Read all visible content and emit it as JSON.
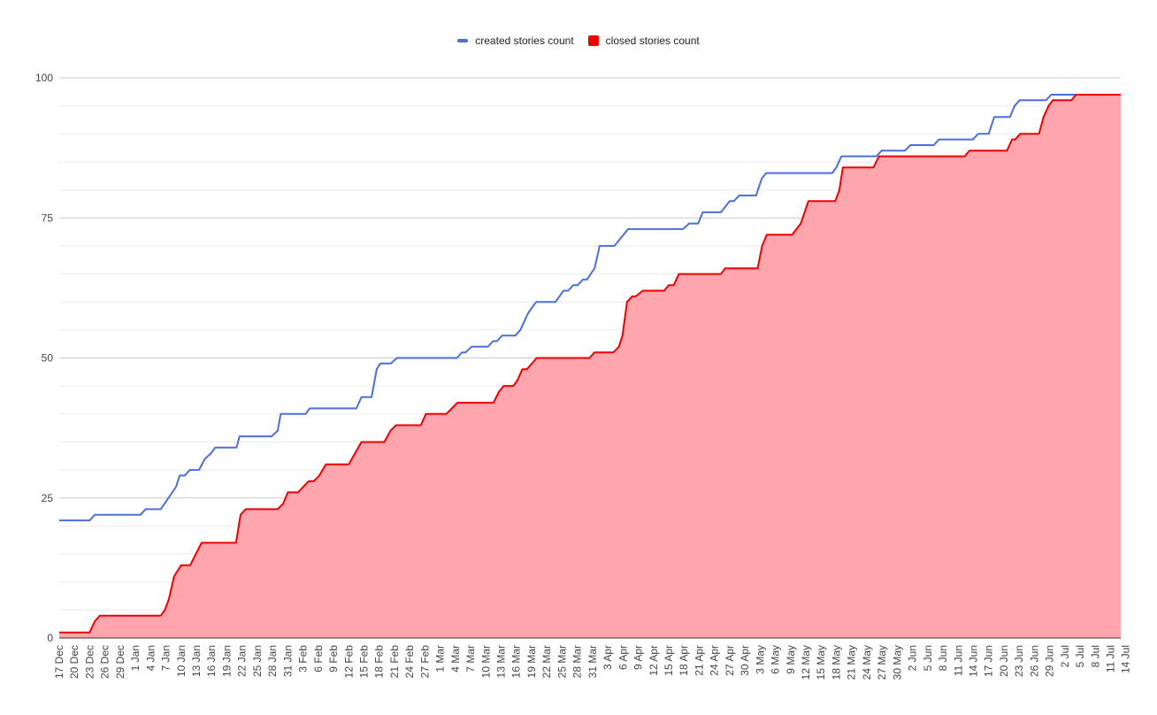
{
  "chart_data": {
    "type": "area",
    "title": "",
    "xlabel": "",
    "ylabel": "",
    "ylim": [
      0,
      100
    ],
    "y_ticks": [
      "0",
      "25",
      "50",
      "75",
      "100"
    ],
    "y_minor_step": 5,
    "grid": true,
    "legend_position": "top-center",
    "x_start": "17 Dec",
    "x_end": "14 Jul",
    "x_total_days": 209,
    "x_tick_labels": [
      "17 Dec",
      "20 Dec",
      "23 Dec",
      "26 Dec",
      "29 Dec",
      "1 Jan",
      "4 Jan",
      "7 Jan",
      "10 Jan",
      "13 Jan",
      "16 Jan",
      "19 Jan",
      "22 Jan",
      "25 Jan",
      "28 Jan",
      "31 Jan",
      "3 Feb",
      "6 Feb",
      "9 Feb",
      "12 Feb",
      "15 Feb",
      "18 Feb",
      "21 Feb",
      "24 Feb",
      "27 Feb",
      "1 Mar",
      "4 Mar",
      "7 Mar",
      "10 Mar",
      "13 Mar",
      "16 Mar",
      "19 Mar",
      "22 Mar",
      "25 Mar",
      "28 Mar",
      "31 Mar",
      "3 Apr",
      "6 Apr",
      "9 Apr",
      "12 Apr",
      "15 Apr",
      "18 Apr",
      "21 Apr",
      "24 Apr",
      "27 Apr",
      "30 Apr",
      "3 May",
      "6 May",
      "9 May",
      "12 May",
      "15 May",
      "18 May",
      "21 May",
      "24 May",
      "27 May",
      "30 May",
      "2 Jun",
      "5 Jun",
      "8 Jun",
      "11 Jun",
      "14 Jun",
      "17 Jun",
      "20 Jun",
      "23 Jun",
      "26 Jun",
      "29 Jun",
      "2 Jul",
      "5 Jul",
      "8 Jul",
      "11 Jul",
      "14 Jul"
    ],
    "series": [
      {
        "name": "created stories count",
        "style": "line",
        "color": "#4a6ee0",
        "points_day_value": [
          [
            0,
            21
          ],
          [
            6,
            21
          ],
          [
            7,
            22
          ],
          [
            16,
            22
          ],
          [
            17,
            23
          ],
          [
            20,
            23
          ],
          [
            23,
            27
          ],
          [
            23.7,
            29
          ],
          [
            24.7,
            29
          ],
          [
            25.7,
            30
          ],
          [
            27.5,
            30
          ],
          [
            28.7,
            32
          ],
          [
            29.9,
            33
          ],
          [
            30.7,
            34
          ],
          [
            34.9,
            34
          ],
          [
            35.5,
            36
          ],
          [
            41.8,
            36
          ],
          [
            43,
            37
          ],
          [
            43.6,
            40
          ],
          [
            48.5,
            40
          ],
          [
            49.3,
            41
          ],
          [
            58.5,
            41
          ],
          [
            59.5,
            43
          ],
          [
            61.5,
            43
          ],
          [
            62.5,
            48
          ],
          [
            63.2,
            49
          ],
          [
            65.3,
            49
          ],
          [
            66.5,
            50
          ],
          [
            78.3,
            50
          ],
          [
            79.3,
            51
          ],
          [
            80,
            51
          ],
          [
            81.2,
            52
          ],
          [
            84.4,
            52
          ],
          [
            85.4,
            53
          ],
          [
            86.2,
            53
          ],
          [
            87.2,
            54
          ],
          [
            89.8,
            54
          ],
          [
            90.8,
            55
          ],
          [
            92.3,
            58
          ],
          [
            93.1,
            59
          ],
          [
            93.9,
            60
          ],
          [
            97.7,
            60
          ],
          [
            99.3,
            62
          ],
          [
            100.2,
            62
          ],
          [
            101.2,
            63
          ],
          [
            102.1,
            63
          ],
          [
            103.1,
            64
          ],
          [
            103.9,
            64
          ],
          [
            105.4,
            66
          ],
          [
            106.4,
            70
          ],
          [
            109.3,
            70
          ],
          [
            112,
            73
          ],
          [
            122.8,
            73
          ],
          [
            124,
            74
          ],
          [
            125.8,
            74
          ],
          [
            126.7,
            76
          ],
          [
            130.3,
            76
          ],
          [
            132,
            78
          ],
          [
            132.8,
            78
          ],
          [
            133.9,
            79
          ],
          [
            137.2,
            79
          ],
          [
            138.3,
            82
          ],
          [
            139.2,
            83
          ],
          [
            152.2,
            83
          ],
          [
            153,
            84
          ],
          [
            154,
            86
          ],
          [
            160.9,
            86
          ],
          [
            161.9,
            87
          ],
          [
            166.5,
            87
          ],
          [
            167.6,
            88
          ],
          [
            172.2,
            88
          ],
          [
            173.2,
            89
          ],
          [
            179.9,
            89
          ],
          [
            180.9,
            90
          ],
          [
            183,
            90
          ],
          [
            184.1,
            93
          ],
          [
            187.2,
            93
          ],
          [
            188.1,
            95
          ],
          [
            189.1,
            96
          ],
          [
            194.3,
            96
          ],
          [
            195.3,
            97
          ],
          [
            209,
            97
          ]
        ]
      },
      {
        "name": "closed stories count",
        "style": "area",
        "color": "#ee0000",
        "fill": "#ffa5ad",
        "points_day_value": [
          [
            0,
            1
          ],
          [
            6,
            1
          ],
          [
            7,
            3
          ],
          [
            8,
            4
          ],
          [
            20,
            4
          ],
          [
            20.8,
            5
          ],
          [
            21.6,
            7
          ],
          [
            22.6,
            11
          ],
          [
            24,
            13
          ],
          [
            25.8,
            13
          ],
          [
            28,
            17
          ],
          [
            34.8,
            17
          ],
          [
            35.7,
            22
          ],
          [
            36.7,
            23
          ],
          [
            43,
            23
          ],
          [
            44.1,
            24
          ],
          [
            45,
            26
          ],
          [
            47,
            26
          ],
          [
            49.1,
            28
          ],
          [
            50.1,
            28
          ],
          [
            51.2,
            29
          ],
          [
            52.5,
            31
          ],
          [
            57,
            31
          ],
          [
            59.5,
            35
          ],
          [
            64,
            35
          ],
          [
            65.2,
            37
          ],
          [
            66.3,
            38
          ],
          [
            71.2,
            38
          ],
          [
            72.2,
            40
          ],
          [
            76.2,
            40
          ],
          [
            78.4,
            42
          ],
          [
            85.5,
            42
          ],
          [
            86.6,
            44
          ],
          [
            87.5,
            45
          ],
          [
            89.4,
            45
          ],
          [
            90.2,
            46
          ],
          [
            91.2,
            48
          ],
          [
            92.1,
            48
          ],
          [
            94,
            50
          ],
          [
            104.4,
            50
          ],
          [
            105.4,
            51
          ],
          [
            109.1,
            51
          ],
          [
            110.2,
            52
          ],
          [
            110.9,
            54
          ],
          [
            111.8,
            60
          ],
          [
            112.8,
            61
          ],
          [
            113.5,
            61
          ],
          [
            114.9,
            62
          ],
          [
            119.1,
            62
          ],
          [
            120,
            63
          ],
          [
            121,
            63
          ],
          [
            122,
            65
          ],
          [
            130.3,
            65
          ],
          [
            131.1,
            66
          ],
          [
            137.5,
            66
          ],
          [
            138.4,
            70
          ],
          [
            139.3,
            72
          ],
          [
            144.3,
            72
          ],
          [
            146,
            74
          ],
          [
            147.5,
            78
          ],
          [
            152.8,
            78
          ],
          [
            153.6,
            80
          ],
          [
            154.3,
            84
          ],
          [
            160.3,
            84
          ],
          [
            161.4,
            86
          ],
          [
            178.3,
            86
          ],
          [
            179.2,
            87
          ],
          [
            186.6,
            87
          ],
          [
            187.6,
            89
          ],
          [
            188.2,
            89
          ],
          [
            189.2,
            90
          ],
          [
            192.9,
            90
          ],
          [
            193.8,
            93
          ],
          [
            194.8,
            95
          ],
          [
            195.6,
            96
          ],
          [
            199.3,
            96
          ],
          [
            200.2,
            97
          ],
          [
            209,
            97
          ]
        ]
      }
    ]
  },
  "legend": {
    "items": [
      {
        "label": "created stories count",
        "color": "#4a6ee0",
        "shape": "line"
      },
      {
        "label": "closed stories count",
        "color": "#ee0000",
        "shape": "box"
      }
    ]
  }
}
